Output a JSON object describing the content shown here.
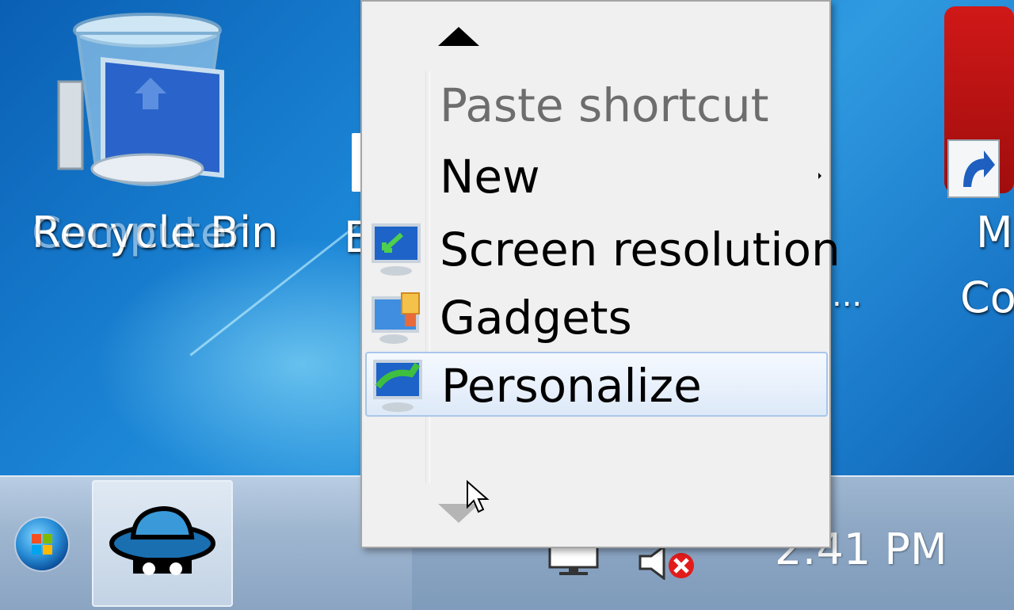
{
  "desktop": {
    "icons": [
      {
        "label": "Recycle Bin",
        "ghost_label": "Computer",
        "name": "recycle-bin"
      },
      {
        "label": "E",
        "name": "partial-icon-left"
      },
      {
        "label": "M",
        "label2": "Co",
        "name": "partial-icon-right"
      }
    ],
    "truncated_label": "..."
  },
  "context_menu": {
    "items": [
      {
        "label": "Paste shortcut",
        "enabled": false,
        "icon": ""
      },
      {
        "label": "New",
        "enabled": true,
        "icon": "",
        "submenu": true
      },
      {
        "label": "Screen resolution",
        "enabled": true,
        "icon": "screen-resolution-icon"
      },
      {
        "label": "Gadgets",
        "enabled": true,
        "icon": "gadgets-icon"
      },
      {
        "label": "Personalize",
        "enabled": true,
        "icon": "personalize-icon",
        "highlighted": true
      }
    ],
    "scroll_up": "scroll-up-arrow",
    "scroll_down": "scroll-down-arrow"
  },
  "taskbar": {
    "clock": "2:41 PM",
    "start": "start-orb",
    "pinned": [
      "app-hat-icon"
    ],
    "tray": [
      "network-icon",
      "volume-muted-icon"
    ]
  },
  "colors": {
    "accent": "#1c86d6",
    "menu_bg": "#f0f0f0",
    "highlight": "#dde9f8"
  }
}
